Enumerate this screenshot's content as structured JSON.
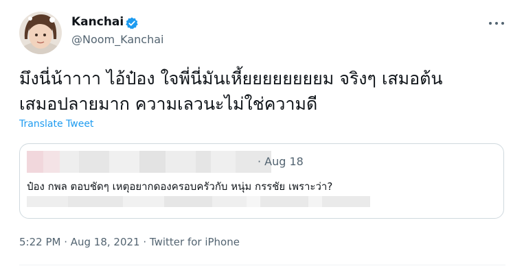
{
  "author": {
    "name": "Kanchai",
    "handle": "@Noom_Kanchai",
    "verified": true
  },
  "tweet": {
    "text_line1": "มึงนี่น้าาาา ไอ้ป๋อง ใจพี่นี่มันเหี้ยยยยยยยยม จริงๆ เสมอต้น",
    "text_line2": "เสมอปลายมาก ความเลวนะไม่ใช่ความดี",
    "translate_label": "Translate Tweet"
  },
  "quoted": {
    "date": "· Aug 18",
    "text": "ป๋อง กพล ตอบชัดๆ เหตุอยากดองครอบครัวกับ หนุ่ม กรรชัย เพราะว่า?"
  },
  "meta": {
    "text": "5:22 PM · Aug 18, 2021 · Twitter for iPhone"
  },
  "icons": {
    "verified": "verified-badge-icon",
    "more": "more-dots-icon"
  },
  "colors": {
    "accent": "#1d9bf0",
    "secondary_text": "#536471",
    "border": "#cfd9de"
  }
}
